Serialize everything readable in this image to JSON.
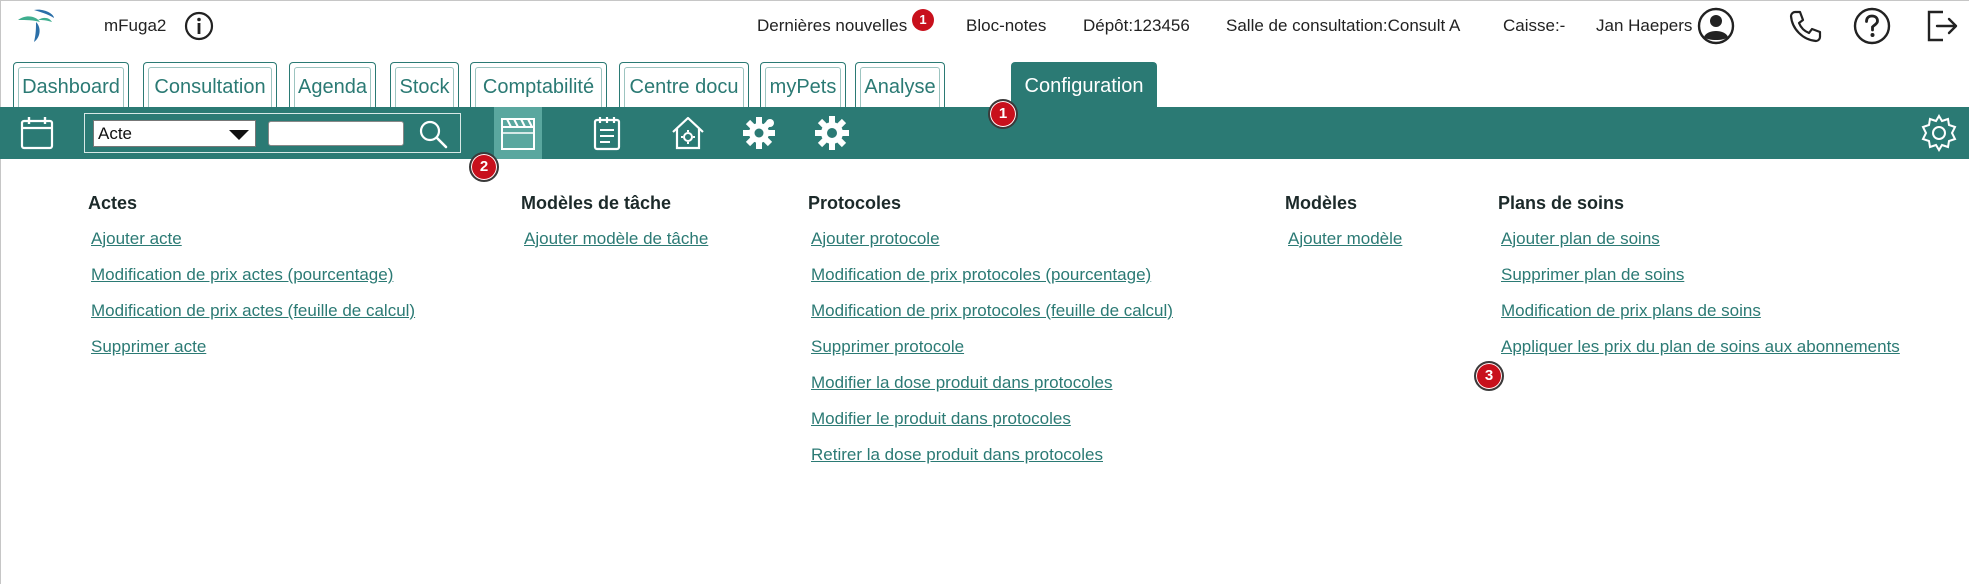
{
  "app": {
    "name": "mFuga2"
  },
  "header": {
    "news_label": "Dernières nouvelles",
    "news_count": "1",
    "notepad_label": "Bloc-notes",
    "depot_label": "Dépôt:123456",
    "room_label": "Salle de consultation:Consult A",
    "cash_label": "Caisse:-",
    "user_name": "Jan Haepers"
  },
  "tabs": [
    {
      "label": "Dashboard"
    },
    {
      "label": "Consultation"
    },
    {
      "label": "Agenda"
    },
    {
      "label": "Stock"
    },
    {
      "label": "Comptabilité"
    },
    {
      "label": "Centre docu"
    },
    {
      "label": "myPets"
    },
    {
      "label": "Analyse"
    },
    {
      "label": "Configuration",
      "active": true
    }
  ],
  "toolbar": {
    "select_value": "Acte",
    "search_value": ""
  },
  "markers": [
    "1",
    "2",
    "3"
  ],
  "columns": [
    {
      "title": "Actes",
      "links": [
        "Ajouter acte",
        "Modification de prix actes (pourcentage)",
        "Modification de prix actes (feuille de calcul)",
        "Supprimer acte"
      ]
    },
    {
      "title": "Modèles de tâche",
      "links": [
        "Ajouter modèle de tâche"
      ]
    },
    {
      "title": "Protocoles",
      "links": [
        "Ajouter protocole",
        "Modification de prix protocoles (pourcentage)",
        "Modification de prix protocoles (feuille de calcul)",
        "Supprimer protocole",
        "Modifier la dose produit dans protocoles",
        "Modifier le produit dans protocoles",
        "Retirer la dose produit dans protocoles"
      ]
    },
    {
      "title": "Modèles",
      "links": [
        "Ajouter modèle"
      ]
    },
    {
      "title": "Plans de soins",
      "links": [
        "Ajouter plan de soins",
        "Supprimer plan de soins",
        "Modification de prix plans de soins",
        "Appliquer les prix du plan de soins aux abonnements"
      ]
    }
  ],
  "colors": {
    "teal": "#2b7a74",
    "teal_light": "#5aa79f",
    "badge_red": "#c8101c"
  }
}
